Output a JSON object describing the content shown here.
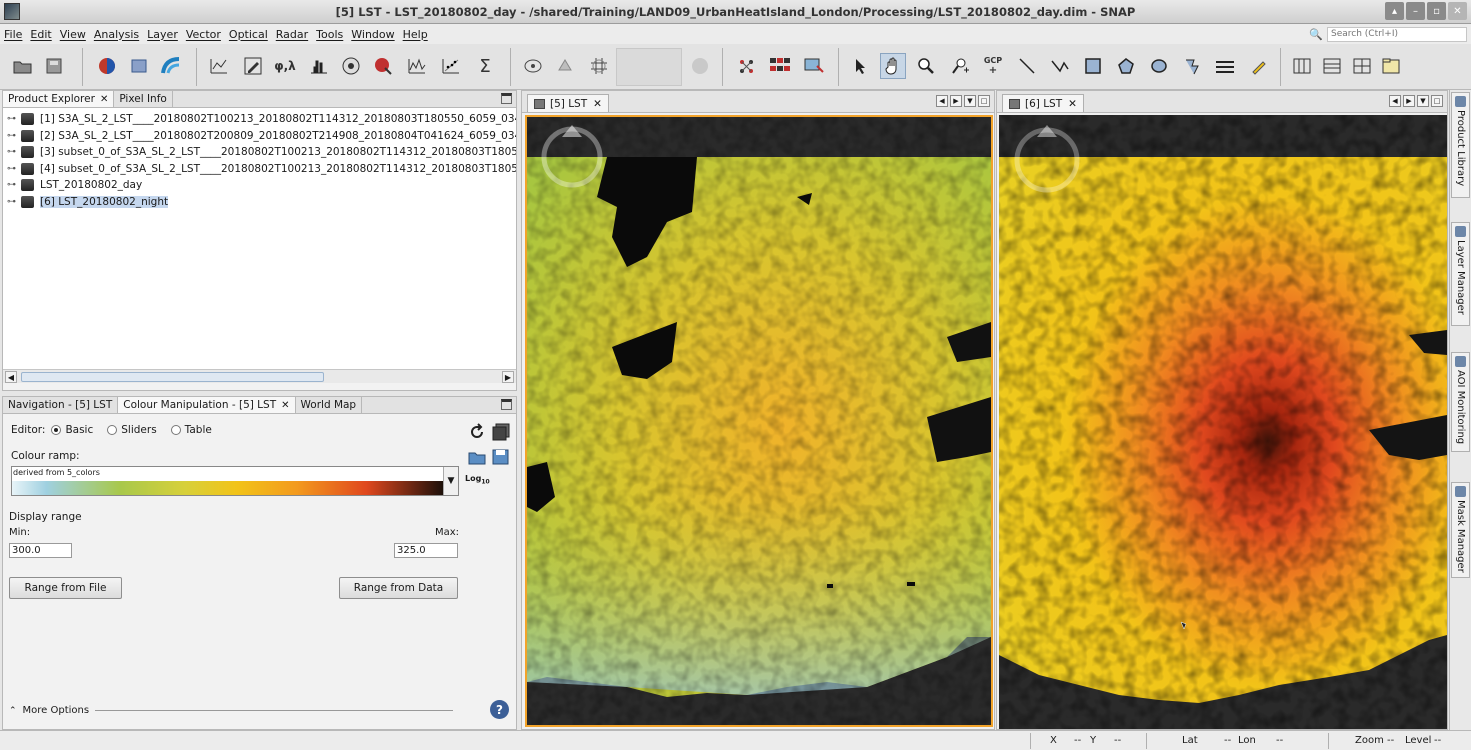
{
  "window": {
    "title": "[5] LST - LST_20180802_day - /shared/Training/LAND09_UrbanHeatIsland_London/Processing/LST_20180802_day.dim - SNAP",
    "buttons": [
      "minimize-icon",
      "restore-icon",
      "close-icon"
    ]
  },
  "menu": {
    "items": [
      "File",
      "Edit",
      "View",
      "Analysis",
      "Layer",
      "Vector",
      "Optical",
      "Radar",
      "Tools",
      "Window",
      "Help"
    ],
    "search_placeholder": "Search (Ctrl+I)"
  },
  "toolbar": {
    "pin_gcp_label": "GCP",
    "phi_lambda_label": "φ,λ",
    "sigma_label": "Σ"
  },
  "product_explorer": {
    "tabs": [
      {
        "label": "Product Explorer",
        "active": true
      },
      {
        "label": "Pixel Info",
        "active": false
      }
    ],
    "products": [
      {
        "label": "[1] S3A_SL_2_LST____20180802T100213_20180802T114312_20180803T180550_6059_034",
        "selected": false
      },
      {
        "label": "[2] S3A_SL_2_LST____20180802T200809_20180802T214908_20180804T041624_6059_034",
        "selected": false
      },
      {
        "label": "[3] subset_0_of_S3A_SL_2_LST____20180802T100213_20180802T114312_20180803T1805",
        "selected": false
      },
      {
        "label": "[4] subset_0_of_S3A_SL_2_LST____20180802T100213_20180802T114312_20180803T1805",
        "selected": false
      },
      {
        "label": "LST_20180802_day",
        "selected": false
      },
      {
        "label": "[6] LST_20180802_night",
        "selected": true
      }
    ]
  },
  "tool_tabs": [
    {
      "label": "Navigation - [5] LST",
      "active": false
    },
    {
      "label": "Colour Manipulation - [5] LST",
      "active": true
    },
    {
      "label": "World Map",
      "active": false
    }
  ],
  "colour_manipulation": {
    "editor_label": "Editor:",
    "editor_options": [
      "Basic",
      "Sliders",
      "Table"
    ],
    "editor_selected": "Basic",
    "ramp_label": "Colour ramp:",
    "ramp_name": "derived from 5_colors",
    "log_label": "Log",
    "log_sub": "10",
    "display_range_label": "Display range",
    "min_label": "Min:",
    "max_label": "Max:",
    "min_value": "300.0",
    "max_value": "325.0",
    "range_file_button": "Range from File",
    "range_data_button": "Range from Data",
    "more_options": "More Options",
    "ramp_colors": [
      "#e8f4f8",
      "#9fd0e0",
      "#a8c84b",
      "#f2c318",
      "#e0481e",
      "#1a0f0a"
    ]
  },
  "views": [
    {
      "tab_label": "[5] LST"
    },
    {
      "tab_label": "[6] LST"
    }
  ],
  "right_sidebar": {
    "tabs": [
      "Product Library",
      "Layer Manager",
      "AOI Monitoring",
      "Mask Manager"
    ]
  },
  "statusbar": {
    "x_label": "X",
    "x_value": "--",
    "y_label": "Y",
    "y_value": "--",
    "lat_label": "Lat",
    "lat_value": "--",
    "lon_label": "Lon",
    "lon_value": "--",
    "zoom_label": "Zoom",
    "zoom_value": "--",
    "level_label": "Level",
    "level_value": "--"
  }
}
